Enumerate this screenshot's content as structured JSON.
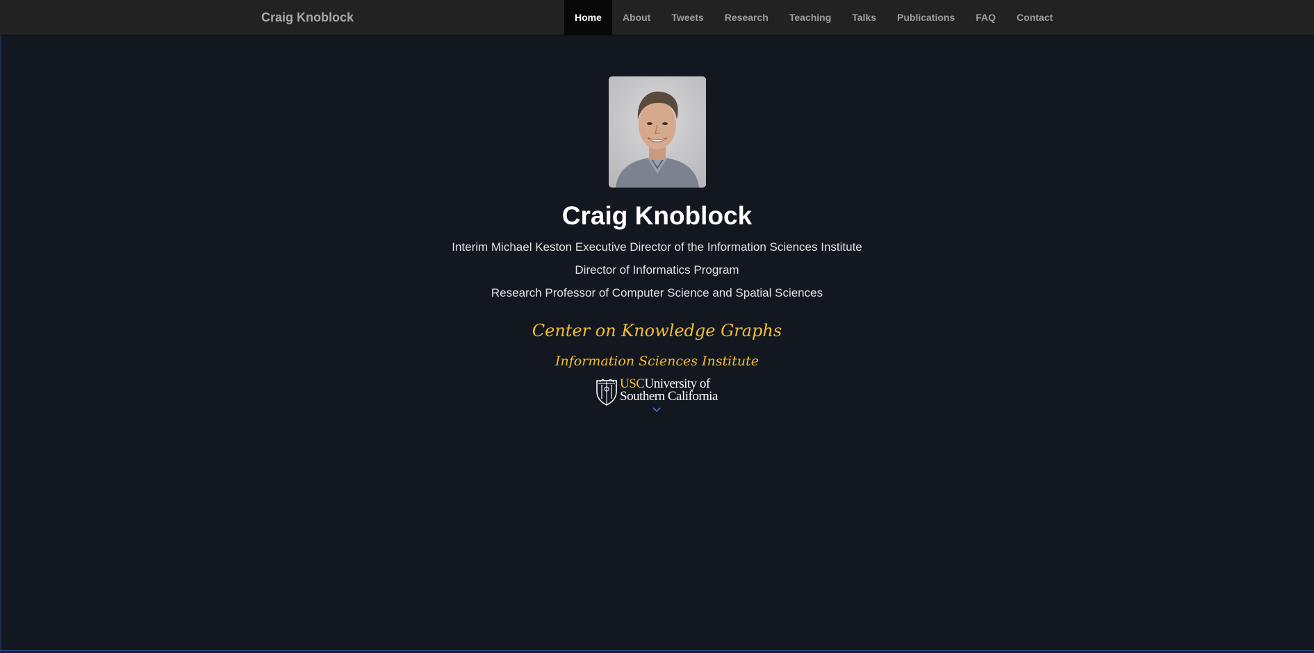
{
  "navbar": {
    "brand": "Craig Knoblock",
    "items": [
      {
        "label": "Home",
        "active": true
      },
      {
        "label": "About",
        "active": false
      },
      {
        "label": "Tweets",
        "active": false
      },
      {
        "label": "Research",
        "active": false
      },
      {
        "label": "Teaching",
        "active": false
      },
      {
        "label": "Talks",
        "active": false
      },
      {
        "label": "Publications",
        "active": false
      },
      {
        "label": "FAQ",
        "active": false
      },
      {
        "label": "Contact",
        "active": false
      }
    ]
  },
  "hero": {
    "name": "Craig Knoblock",
    "titles": [
      "Interim Michael Keston Executive Director of the Information Sciences Institute",
      "Director of Informatics Program",
      "Research Professor of Computer Science and Spatial Sciences"
    ],
    "center": "Center on Knowledge Graphs",
    "institute": "Information Sciences Institute",
    "university": {
      "mark": "USC",
      "line1_rest": "University of",
      "line2": "Southern California"
    }
  },
  "colors": {
    "page_background": "#131720",
    "navbar_background": "#222222",
    "accent_gold": "#f2be2e",
    "chevron_blue": "#4a6fd1"
  },
  "icons": {
    "portrait": "portrait-photo",
    "seal": "usc-seal-icon",
    "scroll": "chevron-down-icon"
  }
}
